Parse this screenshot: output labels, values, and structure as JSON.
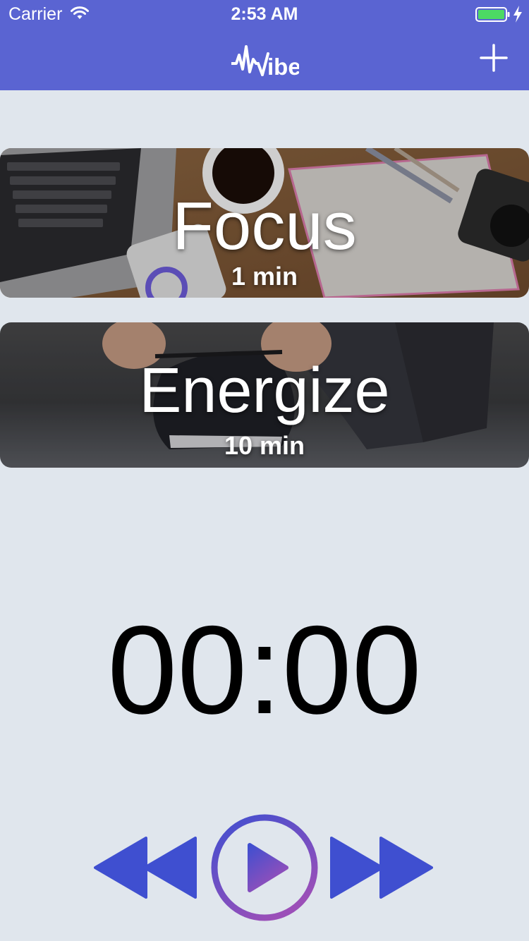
{
  "status_bar": {
    "carrier": "Carrier",
    "time": "2:53 AM",
    "battery_color": "#4cd964"
  },
  "nav": {
    "logo_text": "ibe",
    "add_icon": "plus-icon",
    "background": "#5a64d2"
  },
  "sessions": [
    {
      "title": "Focus",
      "duration": "1 min"
    },
    {
      "title": "Energize",
      "duration": "10 min"
    }
  ],
  "timer": {
    "display": "00:00"
  },
  "controls": {
    "rewind_icon": "rewind-icon",
    "play_icon": "play-icon",
    "forward_icon": "fast-forward-icon",
    "accent": "#3f4fd0",
    "gradient_end": "#9b4fb8"
  }
}
